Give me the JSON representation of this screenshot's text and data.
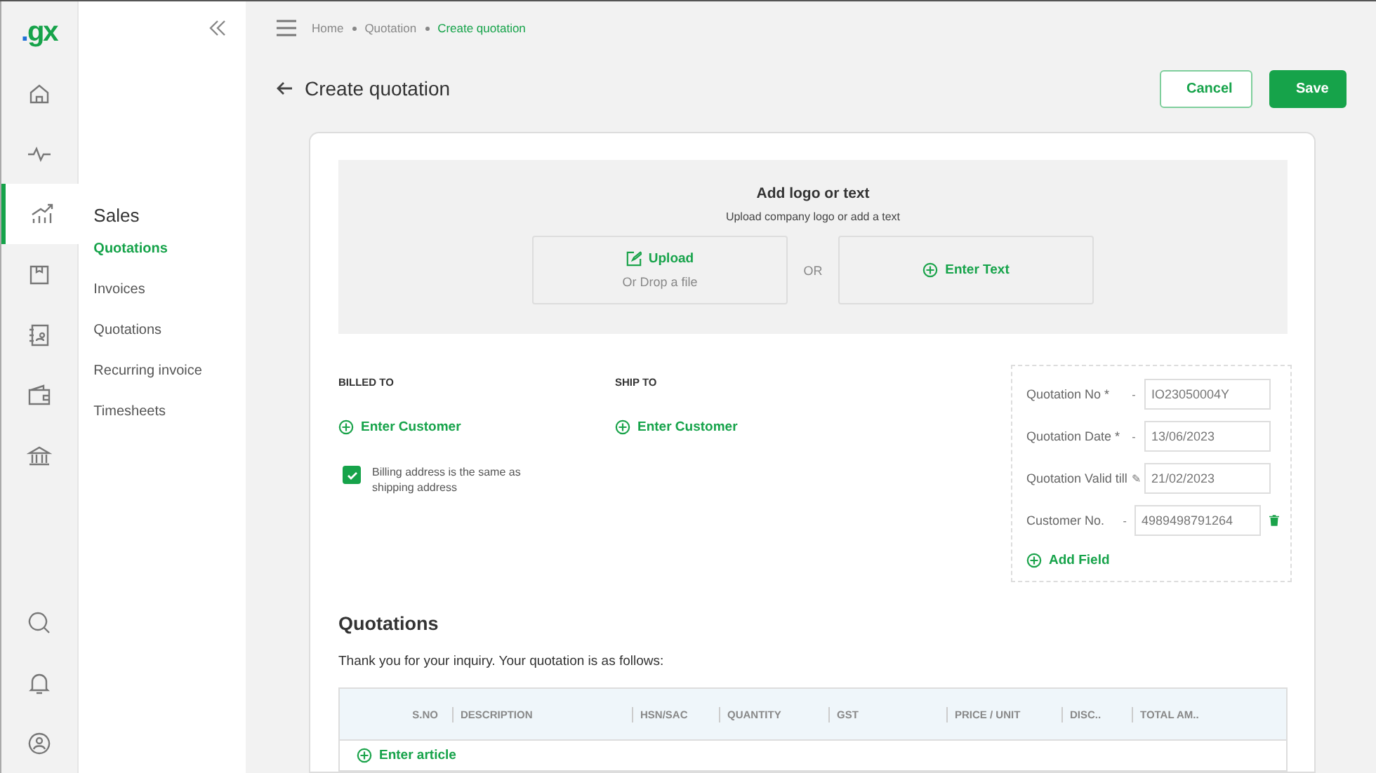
{
  "logo": {
    "dot": ".",
    "text": "gx"
  },
  "rail": [
    {
      "selected": false
    },
    {
      "selected": false
    },
    {
      "selected": true
    },
    {
      "selected": false
    },
    {
      "selected": false
    },
    {
      "selected": false
    },
    {
      "selected": false
    }
  ],
  "sidebar": {
    "title": "Sales",
    "items": [
      {
        "label": "Quotations",
        "selected": true
      },
      {
        "label": "Invoices",
        "selected": false
      },
      {
        "label": "Quotations",
        "selected": false
      },
      {
        "label": "Recurring invoice",
        "selected": false
      },
      {
        "label": "Timesheets",
        "selected": false
      }
    ]
  },
  "breadcrumb": [
    {
      "label": "Home",
      "current": false
    },
    {
      "label": "Quotation",
      "current": false
    },
    {
      "label": "Create quotation",
      "current": true
    }
  ],
  "page_title": "Create quotation",
  "buttons": {
    "cancel": "Cancel",
    "save": "Save"
  },
  "logo_area": {
    "title": "Add logo or text",
    "subtitle": "Upload company logo or add a text",
    "upload": "Upload",
    "drop": "Or Drop a file",
    "or": "OR",
    "enter_text": "Enter Text"
  },
  "billed_to": {
    "heading": "BILLED TO",
    "action": "Enter Customer",
    "same_address": {
      "label": "Billing address is the same as shipping address",
      "checked": true
    }
  },
  "ship_to": {
    "heading": "SHIP TO",
    "action": "Enter Customer"
  },
  "meta_fields": [
    {
      "label": "Quotation No *",
      "separator": "-",
      "value": "IO23050004Y",
      "deletable": false
    },
    {
      "label": "Quotation Date *",
      "separator": "-",
      "value": "13/06/2023",
      "deletable": false
    },
    {
      "label": "Quotation Valid till",
      "separator": "✎",
      "value": "21/02/2023",
      "deletable": false
    },
    {
      "label": "Customer No.",
      "separator": "-",
      "value": "4989498791264",
      "deletable": true
    }
  ],
  "add_field": "Add Field",
  "section": {
    "title": "Quotations",
    "intro": "Thank you for your inquiry. Your quotation is as follows:"
  },
  "table": {
    "columns": [
      "S.NO",
      "DESCRIPTION",
      "HSN/SAC",
      "QUANTITY",
      "GST",
      "PRICE / UNIT",
      "DISC..",
      "TOTAL AM.."
    ],
    "add_row": "Enter article"
  }
}
